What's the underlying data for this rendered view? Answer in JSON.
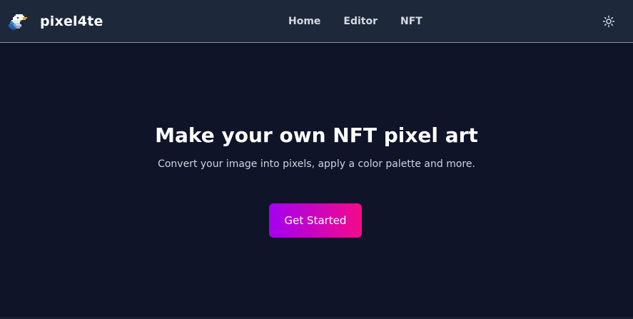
{
  "app": {
    "brand_name": "pixel4te",
    "logo_icon": "pixel-eagle-icon"
  },
  "nav": {
    "links": [
      "Home",
      "Editor",
      "NFT"
    ],
    "theme_toggle_icon": "sun-icon"
  },
  "hero": {
    "title": "Make your own NFT pixel art",
    "subtitle": "Convert your image into pixels, apply a color palette and more.",
    "cta_label": "Get Started"
  },
  "colors": {
    "background": "#0f1429",
    "navbar": "#1e283b",
    "cta_gradient_start": "#a300f0",
    "cta_gradient_end": "#f50a8a"
  }
}
